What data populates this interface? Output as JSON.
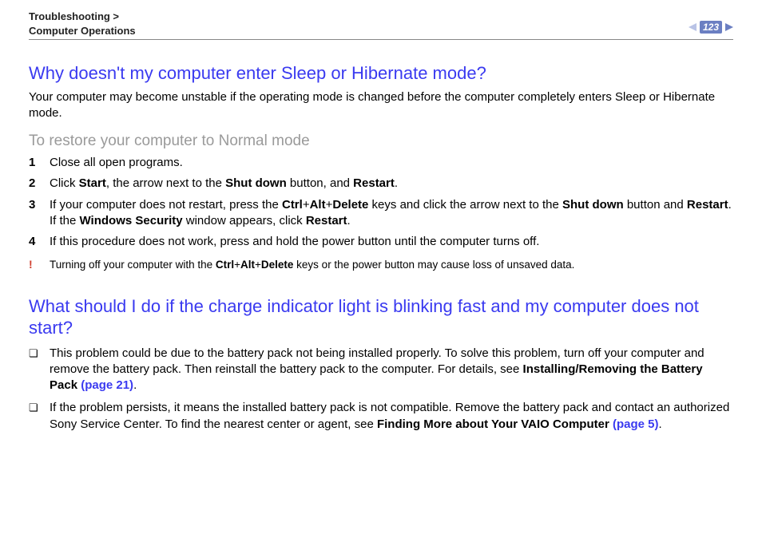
{
  "header": {
    "breadcrumb_line1": "Troubleshooting >",
    "breadcrumb_line2": "Computer Operations",
    "page_number": "123"
  },
  "q1": {
    "title": "Why doesn't my computer enter Sleep or Hibernate mode?",
    "intro": "Your computer may become unstable if the operating mode is changed before the computer completely enters Sleep or Hibernate mode.",
    "subheading": "To restore your computer to Normal mode",
    "steps": [
      {
        "n": "1",
        "pre": "Close all open programs."
      },
      {
        "n": "2",
        "pre": "Click ",
        "b1": "Start",
        "mid1": ", the arrow next to the ",
        "b2": "Shut down",
        "mid2": " button, and ",
        "b3": "Restart",
        "post": "."
      },
      {
        "n": "3",
        "pre": "If your computer does not restart, press the ",
        "b1": "Ctrl",
        "plus1": "+",
        "b2": "Alt",
        "plus2": "+",
        "b3": "Delete",
        "mid1": " keys and click the arrow next to the ",
        "b4": "Shut down",
        "mid2": " button and ",
        "b5": "Restart",
        "post": ".",
        "line2_pre": "If the ",
        "line2_b1": "Windows Security",
        "line2_mid": " window appears, click ",
        "line2_b2": "Restart",
        "line2_post": "."
      },
      {
        "n": "4",
        "pre": "If this procedure does not work, press and hold the power button until the computer turns off."
      }
    ],
    "warning_mark": "!",
    "warning_pre": "Turning off your computer with the ",
    "warning_b1": "Ctrl",
    "warning_plus1": "+",
    "warning_b2": "Alt",
    "warning_plus2": "+",
    "warning_b3": "Delete",
    "warning_post": " keys or the power button may cause loss of unsaved data."
  },
  "q2": {
    "title": "What should I do if the charge indicator light is blinking fast and my computer does not start?",
    "bullet_mark": "❏",
    "bullets": [
      {
        "pre": "This problem could be due to the battery pack not being installed properly. To solve this problem, turn off your computer and remove the battery pack. Then reinstall the battery pack to the computer. For details, see ",
        "b1": "Installing/Removing the Battery Pack ",
        "link": "(page 21)",
        "post": "."
      },
      {
        "pre": "If the problem persists, it means the installed battery pack is not compatible. Remove the battery pack and contact an authorized Sony Service Center. To find the nearest center or agent, see ",
        "b1": "Finding More about Your VAIO Computer ",
        "link": "(page 5)",
        "post": "."
      }
    ]
  }
}
